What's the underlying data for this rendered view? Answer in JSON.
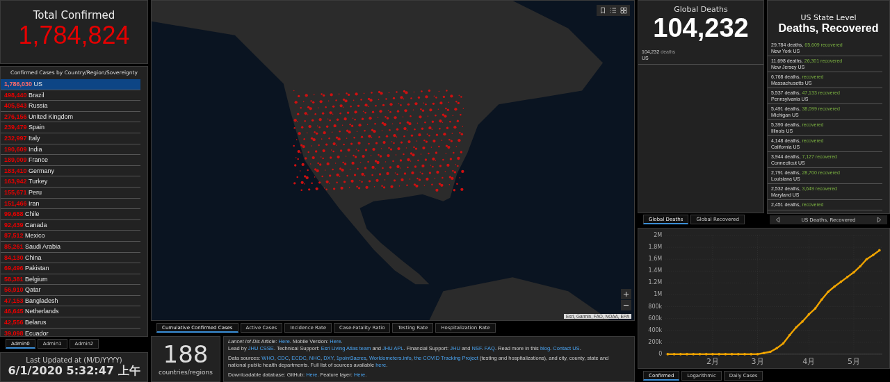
{
  "total_confirmed": {
    "title": "Total Confirmed",
    "value": "1,784,824"
  },
  "country_list": {
    "title": "Confirmed Cases by Country/Region/Sovereignty",
    "items": [
      {
        "count": "1,786,030",
        "name": "US",
        "selected": true
      },
      {
        "count": "498,440",
        "name": "Brazil",
        "selected": false
      },
      {
        "count": "405,843",
        "name": "Russia",
        "selected": false
      },
      {
        "count": "276,156",
        "name": "United Kingdom",
        "selected": false
      },
      {
        "count": "239,479",
        "name": "Spain",
        "selected": false
      },
      {
        "count": "232,997",
        "name": "Italy",
        "selected": false
      },
      {
        "count": "190,609",
        "name": "India",
        "selected": false
      },
      {
        "count": "189,009",
        "name": "France",
        "selected": false
      },
      {
        "count": "183,410",
        "name": "Germany",
        "selected": false
      },
      {
        "count": "163,942",
        "name": "Turkey",
        "selected": false
      },
      {
        "count": "155,671",
        "name": "Peru",
        "selected": false
      },
      {
        "count": "151,466",
        "name": "Iran",
        "selected": false
      },
      {
        "count": "99,688",
        "name": "Chile",
        "selected": false
      },
      {
        "count": "92,439",
        "name": "Canada",
        "selected": false
      },
      {
        "count": "87,512",
        "name": "Mexico",
        "selected": false
      },
      {
        "count": "85,261",
        "name": "Saudi Arabia",
        "selected": false
      },
      {
        "count": "84,130",
        "name": "China",
        "selected": false
      },
      {
        "count": "69,496",
        "name": "Pakistan",
        "selected": false
      },
      {
        "count": "58,381",
        "name": "Belgium",
        "selected": false
      },
      {
        "count": "56,910",
        "name": "Qatar",
        "selected": false
      },
      {
        "count": "47,153",
        "name": "Bangladesh",
        "selected": false
      },
      {
        "count": "46,645",
        "name": "Netherlands",
        "selected": false
      },
      {
        "count": "42,556",
        "name": "Belarus",
        "selected": false
      },
      {
        "count": "39,098",
        "name": "Ecuador",
        "selected": false
      }
    ]
  },
  "admin_tabs": [
    {
      "label": "Admin0",
      "selected": true
    },
    {
      "label": "Admin1",
      "selected": false
    },
    {
      "label": "Admin2",
      "selected": false
    }
  ],
  "last_updated": {
    "label": "Last Updated at (M/D/YYYY)",
    "value": "6/1/2020 5:32:47 上午"
  },
  "map": {
    "attribution": "Esri, Garmin, FAO, NOAA, EPA"
  },
  "map_tabs": [
    {
      "label": "Cumulative Confirmed Cases",
      "selected": true
    },
    {
      "label": "Active Cases",
      "selected": false
    },
    {
      "label": "Incidence Rate",
      "selected": false
    },
    {
      "label": "Case-Fatality Ratio",
      "selected": false
    },
    {
      "label": "Testing Rate",
      "selected": false
    },
    {
      "label": "Hospitalization Rate",
      "selected": false
    }
  ],
  "country_count": {
    "value": "188",
    "label": "countries/regions"
  },
  "info": {
    "paragraphs": [
      {
        "lines": [
          {
            "segments": [
              {
                "kind": "plain",
                "text": "*Lancet Inf Dis* Article: "
              },
              {
                "kind": "link",
                "text": "Here"
              },
              {
                "kind": "plain",
                "text": ". Mobile Version: "
              },
              {
                "kind": "link",
                "text": "Here"
              },
              {
                "kind": "plain",
                "text": "."
              }
            ]
          },
          {
            "segments": [
              {
                "kind": "plain",
                "text": "Lead by "
              },
              {
                "kind": "link",
                "text": "JHU CSSE"
              },
              {
                "kind": "plain",
                "text": ". Technical Support: "
              },
              {
                "kind": "link",
                "text": "Esri Living Atlas team"
              },
              {
                "kind": "plain",
                "text": " and "
              },
              {
                "kind": "link",
                "text": "JHU APL"
              },
              {
                "kind": "plain",
                "text": ". Financial Support: "
              },
              {
                "kind": "link",
                "text": "JHU"
              },
              {
                "kind": "plain",
                "text": " and "
              },
              {
                "kind": "link",
                "text": "NSF"
              },
              {
                "kind": "plain",
                "text": ". "
              },
              {
                "kind": "link",
                "text": "FAQ"
              },
              {
                "kind": "plain",
                "text": ". Read more in this "
              },
              {
                "kind": "link",
                "text": "blog"
              },
              {
                "kind": "plain",
                "text": ". "
              },
              {
                "kind": "link",
                "text": "Contact US"
              },
              {
                "kind": "plain",
                "text": "."
              }
            ]
          }
        ]
      },
      {
        "lines": [
          {
            "segments": [
              {
                "kind": "plain",
                "text": "Data sources: "
              },
              {
                "kind": "link",
                "text": "WHO"
              },
              {
                "kind": "plain",
                "text": ", "
              },
              {
                "kind": "link",
                "text": "CDC"
              },
              {
                "kind": "plain",
                "text": ", "
              },
              {
                "kind": "link",
                "text": "ECDC"
              },
              {
                "kind": "plain",
                "text": ", "
              },
              {
                "kind": "link",
                "text": "NHC"
              },
              {
                "kind": "plain",
                "text": ", "
              },
              {
                "kind": "link",
                "text": "DXY"
              },
              {
                "kind": "plain",
                "text": ", "
              },
              {
                "kind": "link",
                "text": "1point3acres"
              },
              {
                "kind": "plain",
                "text": ", "
              },
              {
                "kind": "link",
                "text": "Worldometers.info"
              },
              {
                "kind": "plain",
                "text": ", "
              },
              {
                "kind": "link",
                "text": "the COVID Tracking Project"
              },
              {
                "kind": "plain",
                "text": " (testing and hospitalizations), and city, county, state and national public health departments. Full list of sources available "
              },
              {
                "kind": "link",
                "text": "here"
              },
              {
                "kind": "plain",
                "text": "."
              }
            ]
          }
        ]
      },
      {
        "lines": [
          {
            "segments": [
              {
                "kind": "plain",
                "text": "Downloadable database: GitHub: "
              },
              {
                "kind": "link",
                "text": "Here"
              },
              {
                "kind": "plain",
                "text": ". Feature layer: "
              },
              {
                "kind": "link",
                "text": "Here"
              },
              {
                "kind": "plain",
                "text": "."
              }
            ]
          }
        ]
      }
    ]
  },
  "global_deaths": {
    "title": "Global Deaths",
    "value": "104,232",
    "items": [
      {
        "count": "104,232",
        "unit": "deaths",
        "place": "US"
      }
    ]
  },
  "deaths_tabs": [
    {
      "label": "Global Deaths",
      "selected": true
    },
    {
      "label": "Global Recovered",
      "selected": false
    }
  ],
  "us_states": {
    "subtitle": "US State Level",
    "title": "Deaths, Recovered",
    "items": [
      {
        "deaths": "29,784 deaths,",
        "recovered": "65,609",
        "recovered_label": "recovered",
        "place": "New York US"
      },
      {
        "deaths": "11,698 deaths,",
        "recovered": "26,301",
        "recovered_label": "recovered",
        "place": "New Jersey US"
      },
      {
        "deaths": "6,768 deaths,",
        "recovered_label": "recovered",
        "place": "Massachusetts US"
      },
      {
        "deaths": "5,537 deaths,",
        "recovered": "47,133",
        "recovered_label": "recovered",
        "place": "Pennsylvania US"
      },
      {
        "deaths": "5,491 deaths,",
        "recovered": "38,099",
        "recovered_label": "recovered",
        "place": "Michigan US"
      },
      {
        "deaths": "5,390 deaths,",
        "recovered_label": "recovered",
        "place": "Illinois US"
      },
      {
        "deaths": "4,148 deaths,",
        "recovered_label": "recovered",
        "place": "California US"
      },
      {
        "deaths": "3,944 deaths,",
        "recovered": "7,127",
        "recovered_label": "recovered",
        "place": "Connecticut US"
      },
      {
        "deaths": "2,791 deaths,",
        "recovered": "28,700",
        "recovered_label": "recovered",
        "place": "Louisiana US"
      },
      {
        "deaths": "2,532 deaths,",
        "recovered": "3,649",
        "recovered_label": "recovered",
        "place": "Maryland US"
      },
      {
        "deaths": "2,451 deaths,",
        "recovered_label": "recovered"
      }
    ],
    "footer": "US Deaths, Recovered"
  },
  "chart_panel": {
    "chart_data": {
      "type": "line",
      "categories": [
        null,
        null,
        null,
        null,
        null,
        null,
        null,
        "2月",
        null,
        null,
        null,
        null,
        null,
        null,
        "3月",
        null,
        null,
        null,
        null,
        null,
        null,
        null,
        "4月",
        null,
        null,
        null,
        null,
        null,
        null,
        "5月",
        null,
        null,
        null,
        null
      ],
      "series": [
        {
          "color": "#f0a400",
          "values": [
            0,
            0,
            0,
            0,
            0,
            0,
            0,
            0,
            0,
            0,
            0,
            0,
            0,
            0,
            0,
            20000,
            40000,
            100000,
            180000,
            320000,
            450000,
            550000,
            670000,
            770000,
            920000,
            1050000,
            1140000,
            1220000,
            1300000,
            1380000,
            1480000,
            1600000,
            1670000,
            1750000
          ]
        }
      ],
      "ylim": [
        0,
        2000000
      ],
      "grid": true,
      "yticks": [
        {
          "value": 0,
          "label": "0"
        },
        {
          "value": 200000,
          "label": "200k"
        },
        {
          "value": 400000,
          "label": "400k"
        },
        {
          "value": 600000,
          "label": "600k"
        },
        {
          "value": 800000,
          "label": "800k"
        },
        {
          "value": 1000000,
          "label": "1M"
        },
        {
          "value": 1200000,
          "label": "1.2M"
        },
        {
          "value": 1400000,
          "label": "1.4M"
        },
        {
          "value": 1600000,
          "label": "1.6M"
        },
        {
          "value": 1800000,
          "label": "1.8M"
        },
        {
          "value": 2000000,
          "label": "2M"
        }
      ]
    },
    "tabs": [
      {
        "label": "Confirmed",
        "selected": true
      },
      {
        "label": "Logarithmic",
        "selected": false
      },
      {
        "label": "Daily Cases",
        "selected": false
      }
    ]
  }
}
